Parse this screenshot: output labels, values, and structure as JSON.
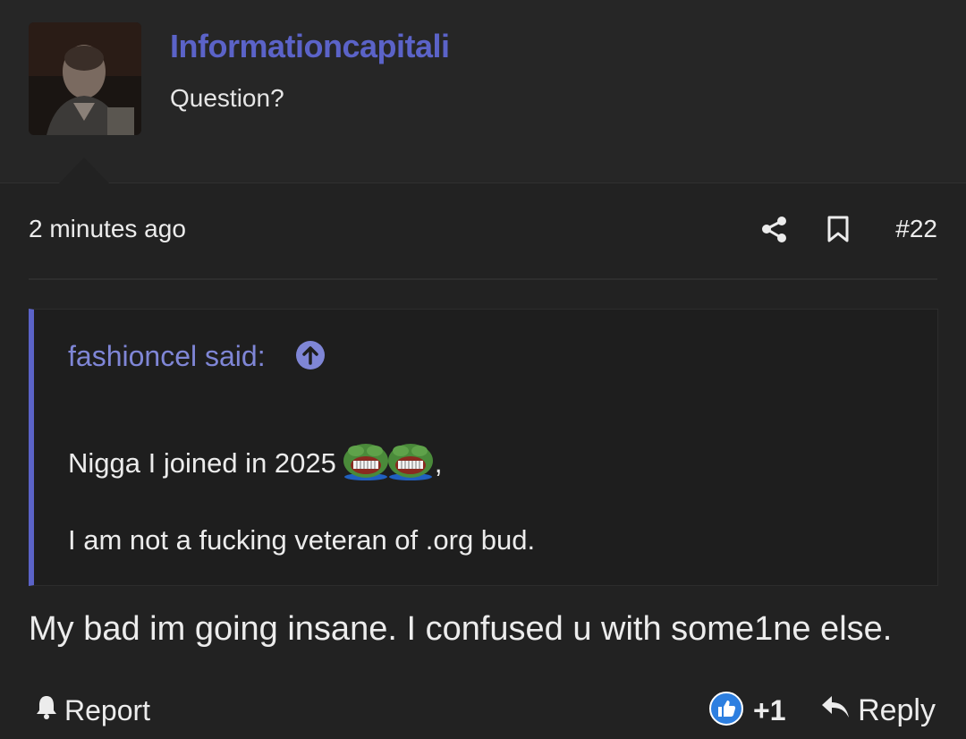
{
  "post": {
    "username": "Informationcapitali",
    "user_title": "Question?",
    "timestamp": "2 minutes ago",
    "post_number": "#22",
    "quote": {
      "author": "fashioncel said:",
      "line1": "Nigga I joined in 2025",
      "line1_suffix": ",",
      "line2": "I am not a fucking veteran of .org bud."
    },
    "body": "My bad im going insane. I confused u with some1ne else.",
    "actions": {
      "report": "Report",
      "like_count": "+1",
      "reply": "Reply"
    }
  },
  "colors": {
    "accent": "#5b63c8",
    "quote_author": "#7f86d6",
    "background": "#222222",
    "header_background": "#262626",
    "like_badge": "#2d7fe0"
  },
  "icons": [
    "share-icon",
    "bookmark-icon",
    "arrow-up-circle-icon",
    "bell-icon",
    "thumbs-up-icon",
    "reply-icon",
    "pepe-laugh-emoji"
  ]
}
